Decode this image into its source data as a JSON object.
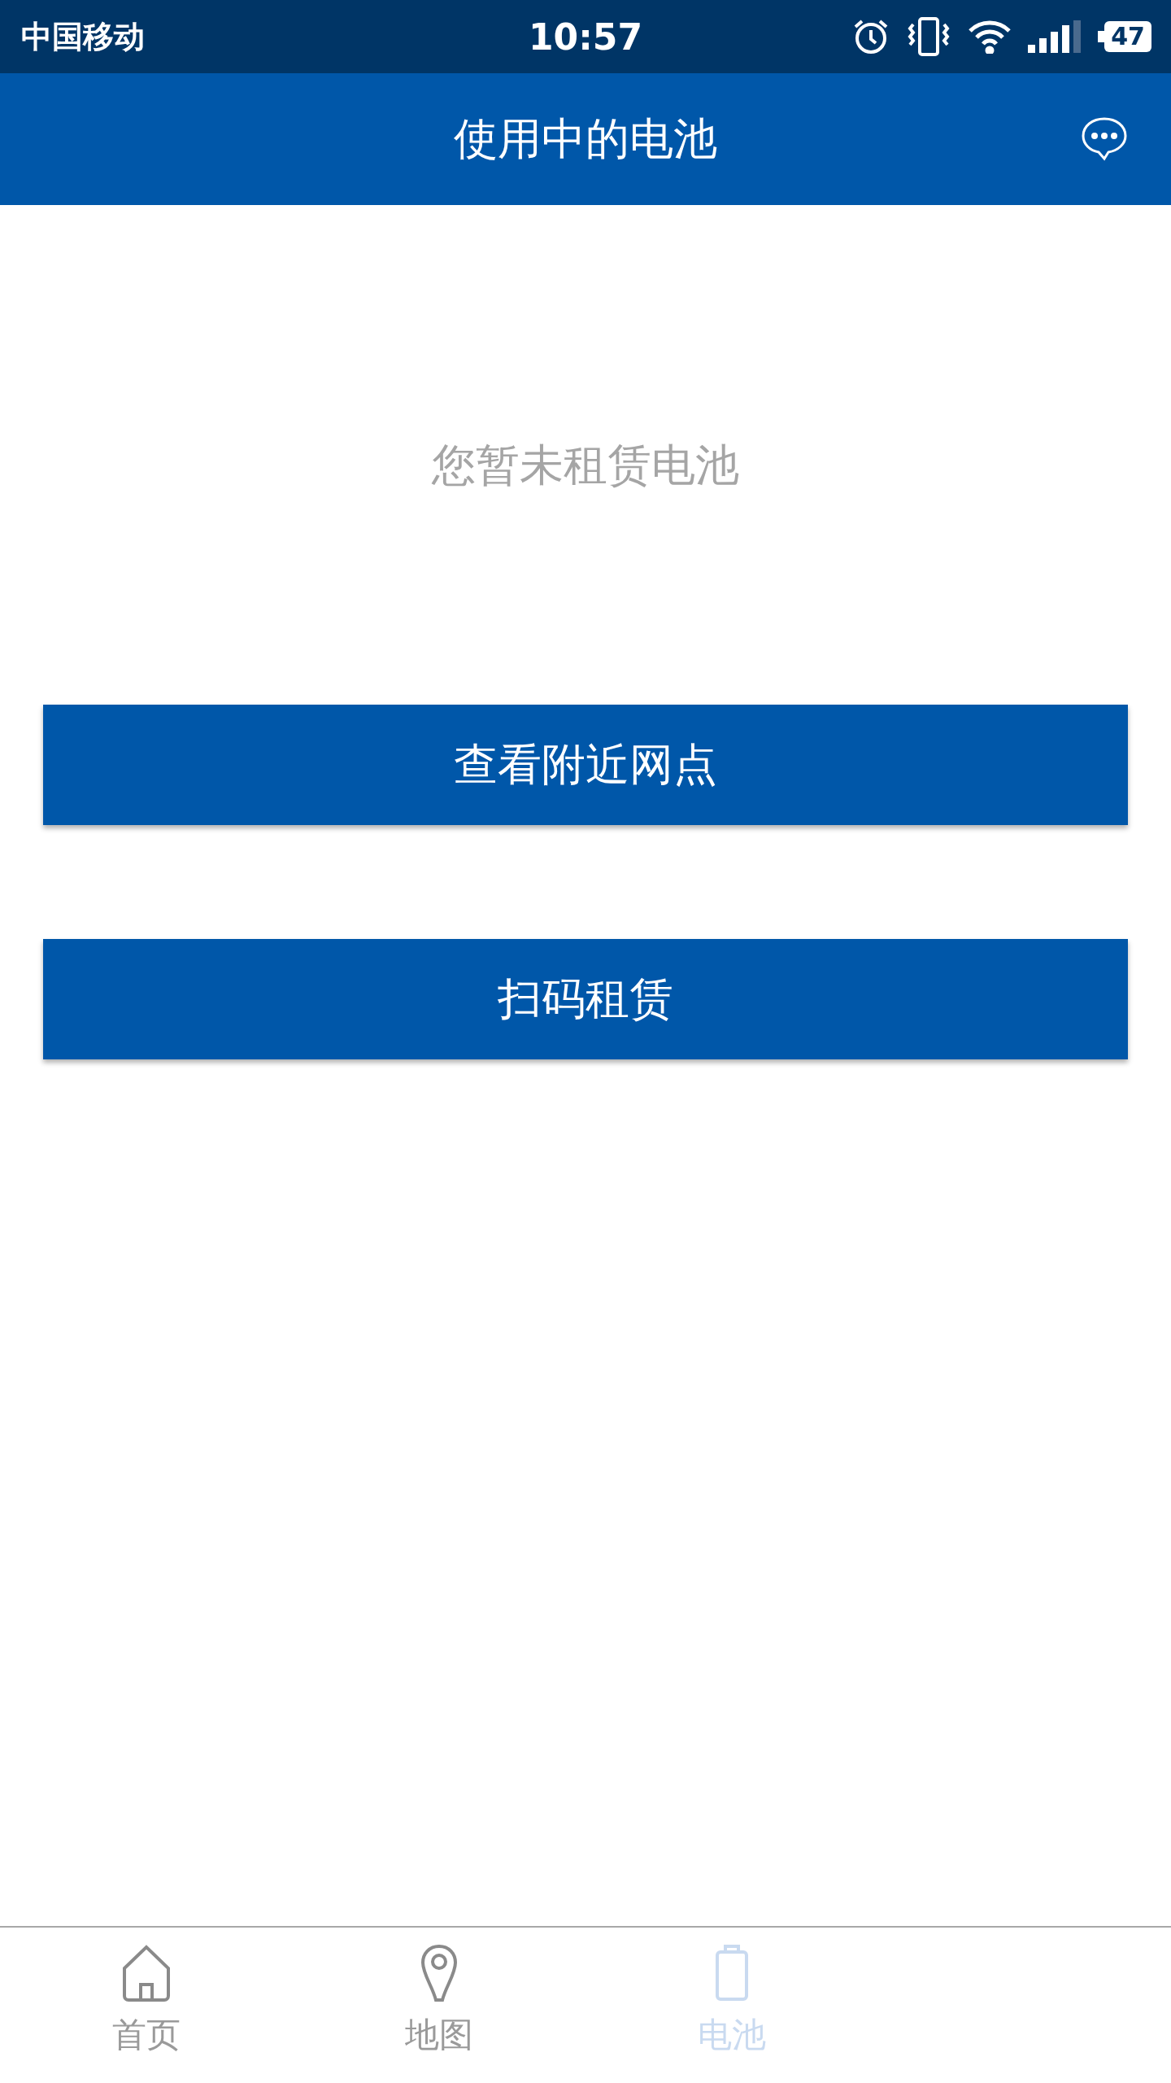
{
  "status_bar": {
    "carrier": "中国移动",
    "time": "10:57",
    "battery": "47"
  },
  "header": {
    "title": "使用中的电池"
  },
  "empty_message": "您暂未租赁电池",
  "buttons": [
    "查看附近网点",
    "扫码租赁"
  ],
  "tab_bar": [
    {
      "label": "首页",
      "kind": "home",
      "selected": false
    },
    {
      "label": "地图",
      "kind": "map",
      "selected": false
    },
    {
      "label": "电池",
      "kind": "battery",
      "selected": true
    }
  ]
}
